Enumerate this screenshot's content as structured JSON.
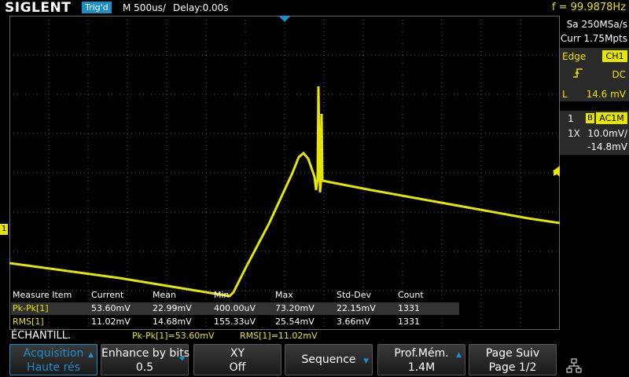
{
  "header": {
    "brand": "SIGLENT",
    "trigger_status": "Trig'd",
    "timebase": "M 500us/",
    "delay": "Delay:0.00s",
    "frequency": "f = 99.9878Hz"
  },
  "acquisition_info": {
    "sample_rate": "Sa 250MSa/s",
    "memory": "Curr 1.75Mpts"
  },
  "trigger_panel": {
    "type_label": "Edge",
    "source": "CH1",
    "coupling": "DC",
    "level_prefix": "L",
    "level": "14.6 mV"
  },
  "channel_panel": {
    "channel_number": "1",
    "bandwidth_flag": "B",
    "coupling": "AC1M",
    "probe": "1X",
    "volts_per_div": "10.0mV/",
    "offset": "-14.8mV"
  },
  "measurements": {
    "headers": [
      "Measure Item",
      "Current",
      "Mean",
      "Min",
      "Max",
      "Std-Dev",
      "Count"
    ],
    "rows": [
      [
        "Pk-Pk[1]",
        "53.60mV",
        "22.99mV",
        "400.00uV",
        "73.20mV",
        "22.15mV",
        "1331"
      ],
      [
        "RMS[1]",
        "11.02mV",
        "14.68mV",
        "155.33uV",
        "25.54mV",
        "3.66mV",
        "1331"
      ]
    ]
  },
  "status_line": {
    "sample_mode": "ÉCHANTILL.",
    "stat_1": "Pk-Pk[1]=53.60mV",
    "stat_2": "RMS[1]=11.02mV"
  },
  "softkeys": [
    {
      "label": "Acquisition",
      "value": "Haute rés"
    },
    {
      "label": "Enhance by bits",
      "value": "0.5"
    },
    {
      "label": "XY",
      "value": "Off"
    },
    {
      "label": "Sequence",
      "value": ""
    },
    {
      "label": "Prof.Mém.",
      "value": "1.4M"
    },
    {
      "label": "Page Suiv",
      "value": "Page 1/2"
    }
  ],
  "markers": {
    "channel_marker": "1"
  },
  "colors": {
    "trace": "#e6e600",
    "accent_blue": "#1f8ec5",
    "background": "#000000"
  }
}
